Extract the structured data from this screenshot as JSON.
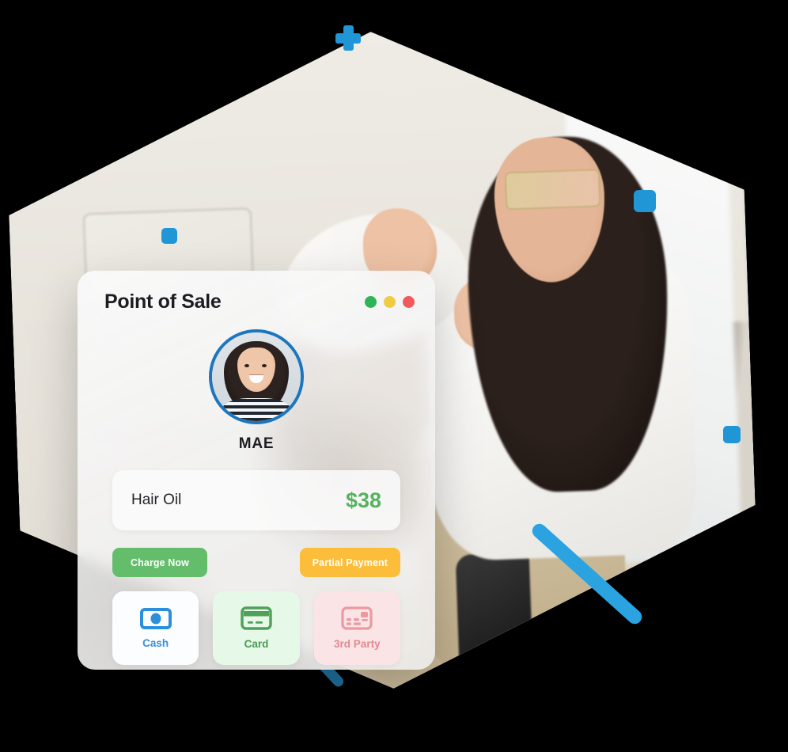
{
  "window": {
    "title": "Point of Sale",
    "dots": [
      {
        "name": "minimize",
        "color": "#2fb457"
      },
      {
        "name": "maximize",
        "color": "#f0cc45"
      },
      {
        "name": "close",
        "color": "#ef5b5b"
      }
    ]
  },
  "customer": {
    "name": "MAE",
    "avatar_icon": "customer-avatar-photo"
  },
  "line_item": {
    "name": "Hair Oil",
    "price": "$38",
    "price_color": "#55b35f"
  },
  "actions": {
    "charge_label": "Charge Now",
    "charge_color": "#63bd6a",
    "partial_label": "Partial Payment",
    "partial_color": "#fbbd3a"
  },
  "payment_methods": [
    {
      "label": "Cash",
      "icon": "banknote-icon",
      "color": "#3e8fd4",
      "bg": "#fcfdff"
    },
    {
      "label": "Card",
      "icon": "credit-card-icon",
      "color": "#4b9a55",
      "bg": "#e6f8e8"
    },
    {
      "label": "3rd Party",
      "icon": "payment-card-chip-icon",
      "color": "#e28a92",
      "bg": "#fbe4e6"
    }
  ],
  "decor": {
    "accent_color": "#2196d6",
    "bar_color": "#2ba3e0",
    "bar_dark_color": "#1f6f9e",
    "hero_alt": "hair-stylist-styling-client-photo"
  }
}
